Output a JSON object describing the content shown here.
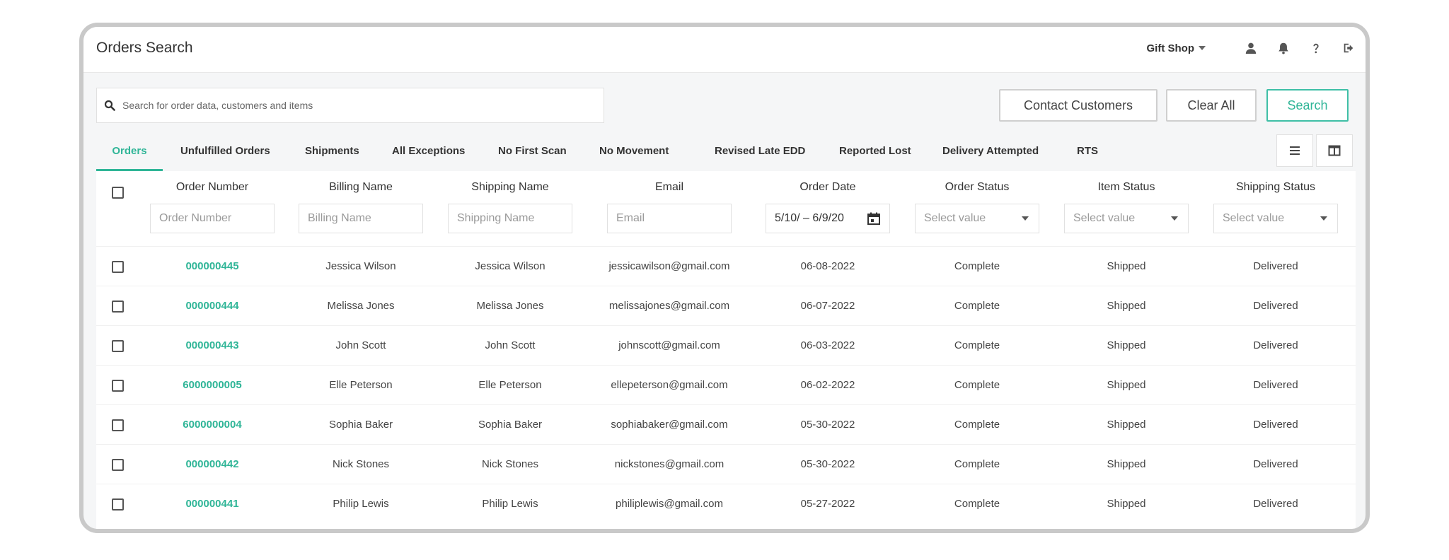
{
  "app": {
    "title": "Orders Search"
  },
  "topbar": {
    "shop_name": "Gift Shop"
  },
  "search": {
    "placeholder": "Search for order data, customers and items"
  },
  "actions": {
    "contact_label": "Contact Customers",
    "clear_label": "Clear All",
    "search_label": "Search"
  },
  "tabs": [
    {
      "label": "Orders",
      "active": true
    },
    {
      "label": "Unfulfilled Orders"
    },
    {
      "label": "Shipments"
    },
    {
      "label": "All Exceptions"
    },
    {
      "label": "No First Scan"
    },
    {
      "label": "No Movement"
    },
    {
      "label": "Revised Late EDD"
    },
    {
      "label": "Reported Lost"
    },
    {
      "label": "Delivery Attempted"
    },
    {
      "label": "RTS"
    }
  ],
  "columns": {
    "order_number": "Order Number",
    "billing_name": "Billing Name",
    "shipping_name": "Shipping Name",
    "email": "Email",
    "order_date": "Order Date",
    "order_status": "Order Status",
    "item_status": "Item Status",
    "shipping_status": "Shipping Status"
  },
  "filters": {
    "order_number_placeholder": "Order Number",
    "billing_name_placeholder": "Billing Name",
    "shipping_name_placeholder": "Shipping Name",
    "email_placeholder": "Email",
    "date_range": "5/10/ – 6/9/20",
    "select_placeholder": "Select value"
  },
  "rows": [
    {
      "order": "000000445",
      "billing": "Jessica Wilson",
      "shipping": "Jessica Wilson",
      "email": "jessicawilson@gmail.com",
      "date": "06-08-2022",
      "order_status": "Complete",
      "item_status": "Shipped",
      "shipping_status": "Delivered"
    },
    {
      "order": "000000444",
      "billing": "Melissa Jones",
      "shipping": "Melissa Jones",
      "email": "melissajones@gmail.com",
      "date": "06-07-2022",
      "order_status": "Complete",
      "item_status": "Shipped",
      "shipping_status": "Delivered"
    },
    {
      "order": "000000443",
      "billing": "John Scott",
      "shipping": "John Scott",
      "email": "johnscott@gmail.com",
      "date": "06-03-2022",
      "order_status": "Complete",
      "item_status": "Shipped",
      "shipping_status": "Delivered"
    },
    {
      "order": "6000000005",
      "billing": "Elle Peterson",
      "shipping": "Elle Peterson",
      "email": "ellepeterson@gmail.com",
      "date": "06-02-2022",
      "order_status": "Complete",
      "item_status": "Shipped",
      "shipping_status": "Delivered"
    },
    {
      "order": "6000000004",
      "billing": "Sophia Baker",
      "shipping": "Sophia Baker",
      "email": "sophiabaker@gmail.com",
      "date": "05-30-2022",
      "order_status": "Complete",
      "item_status": "Shipped",
      "shipping_status": "Delivered"
    },
    {
      "order": "000000442",
      "billing": "Nick Stones",
      "shipping": "Nick Stones",
      "email": "nickstones@gmail.com",
      "date": "05-30-2022",
      "order_status": "Complete",
      "item_status": "Shipped",
      "shipping_status": "Delivered"
    },
    {
      "order": "000000441",
      "billing": "Philip Lewis",
      "shipping": "Philip Lewis",
      "email": "philiplewis@gmail.com",
      "date": "05-27-2022",
      "order_status": "Complete",
      "item_status": "Shipped",
      "shipping_status": "Delivered"
    }
  ],
  "icons": {
    "user": "user-icon",
    "bell": "bell-icon",
    "help": "help-icon",
    "logout": "logout-icon",
    "search": "search-icon",
    "list_view": "list-view-icon",
    "column_view": "column-view-icon",
    "calendar": "calendar-icon"
  },
  "colors": {
    "accent": "#2fb597"
  }
}
